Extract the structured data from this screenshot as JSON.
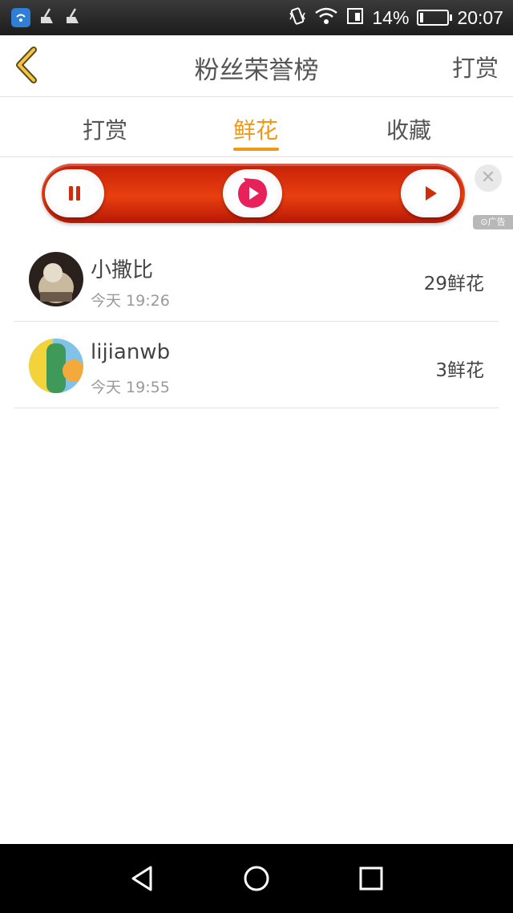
{
  "status_bar": {
    "battery": "14%",
    "time": "20:07",
    "battery_level": 0.14,
    "icons": [
      "wifi-app-icon",
      "cleaner-icon",
      "cleaner-icon",
      "vibrate-icon",
      "wifi-icon",
      "sim-icon",
      "battery-icon"
    ]
  },
  "header": {
    "title": "粉丝荣誉榜",
    "action": "打赏",
    "back_icon": "chevron-left-icon"
  },
  "tabs": [
    {
      "label": "打赏",
      "active": false
    },
    {
      "label": "鲜花",
      "active": true
    },
    {
      "label": "收藏",
      "active": false
    }
  ],
  "ad": {
    "tag": "广告",
    "close_icon": "close-icon",
    "buttons": [
      "pause-icon",
      "video-logo-icon",
      "play-icon"
    ]
  },
  "list": [
    {
      "name": "小撒比",
      "time": "今天 19:26",
      "count": "29鲜花"
    },
    {
      "name": "lijianwb",
      "time": "今天 19:55",
      "count": "3鲜花"
    }
  ],
  "nav_bar": [
    "back-triangle-icon",
    "home-circle-icon",
    "recents-square-icon"
  ],
  "colors": {
    "accent": "#f19716",
    "ad_red": "#d9330c"
  }
}
